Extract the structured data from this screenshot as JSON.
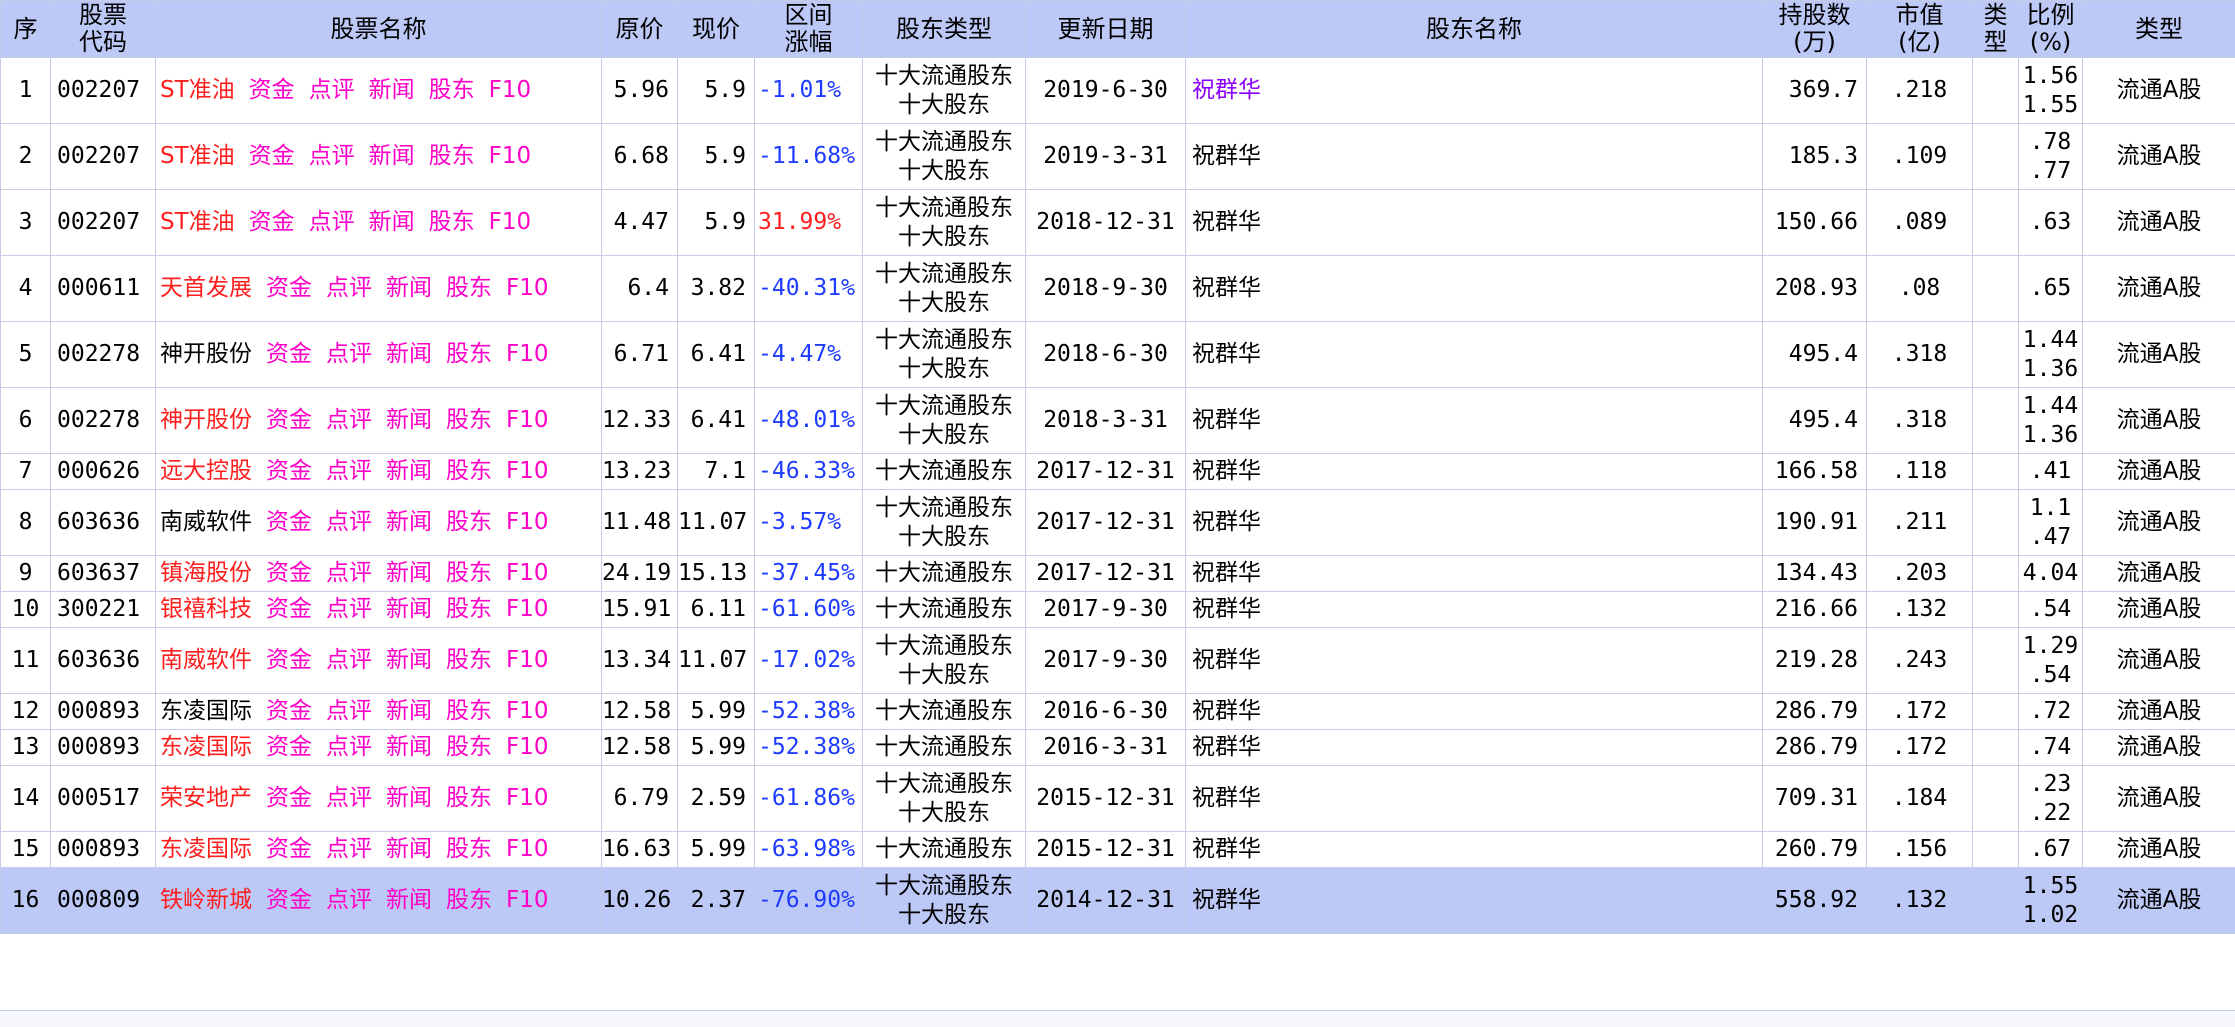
{
  "headers": {
    "seq": "序",
    "code": "股票\n代码",
    "name": "股票名称",
    "orig_price": "原价",
    "cur_price": "现价",
    "range_change": "区间\n涨幅",
    "holder_type": "股东类型",
    "update_date": "更新日期",
    "holder_name": "股东名称",
    "shares": "持股数\n(万)",
    "market_value": "市值\n(亿)",
    "kind": "类\n型",
    "ratio": "比例\n(%)",
    "share_type": "类型"
  },
  "link_labels": [
    "资金",
    "点评",
    "新闻",
    "股东",
    "F10"
  ],
  "rows": [
    {
      "seq": "1",
      "code": "002207",
      "stock": "ST准油",
      "stock_color": "red",
      "orig": "5.96",
      "cur": "5.9",
      "change": "-1.01%",
      "holder_type": [
        "十大流通股东",
        "十大股东"
      ],
      "date": "2019-6-30",
      "holder": "祝群华",
      "holder_color": "purple",
      "shares": "369.7",
      "mv": ".218",
      "ratio": [
        "1.56",
        "1.55"
      ],
      "type": "流通A股"
    },
    {
      "seq": "2",
      "code": "002207",
      "stock": "ST准油",
      "stock_color": "red",
      "orig": "6.68",
      "cur": "5.9",
      "change": "-11.68%",
      "holder_type": [
        "十大流通股东",
        "十大股东"
      ],
      "date": "2019-3-31",
      "holder": "祝群华",
      "holder_color": "black",
      "shares": "185.3",
      "mv": ".109",
      "ratio": [
        ".78",
        ".77"
      ],
      "type": "流通A股"
    },
    {
      "seq": "3",
      "code": "002207",
      "stock": "ST准油",
      "stock_color": "red",
      "orig": "4.47",
      "cur": "5.9",
      "change": "31.99%",
      "holder_type": [
        "十大流通股东",
        "十大股东"
      ],
      "date": "2018-12-31",
      "holder": "祝群华",
      "holder_color": "black",
      "shares": "150.66",
      "mv": ".089",
      "ratio": [
        ".63"
      ],
      "type": "流通A股"
    },
    {
      "seq": "4",
      "code": "000611",
      "stock": "天首发展",
      "stock_color": "red",
      "orig": "6.4",
      "cur": "3.82",
      "change": "-40.31%",
      "holder_type": [
        "十大流通股东",
        "十大股东"
      ],
      "date": "2018-9-30",
      "holder": "祝群华",
      "holder_color": "black",
      "shares": "208.93",
      "mv": ".08",
      "ratio": [
        ".65"
      ],
      "type": "流通A股"
    },
    {
      "seq": "5",
      "code": "002278",
      "stock": "神开股份",
      "stock_color": "black",
      "orig": "6.71",
      "cur": "6.41",
      "change": "-4.47%",
      "holder_type": [
        "十大流通股东",
        "十大股东"
      ],
      "date": "2018-6-30",
      "holder": "祝群华",
      "holder_color": "black",
      "shares": "495.4",
      "mv": ".318",
      "ratio": [
        "1.44",
        "1.36"
      ],
      "type": "流通A股"
    },
    {
      "seq": "6",
      "code": "002278",
      "stock": "神开股份",
      "stock_color": "red",
      "orig": "12.33",
      "cur": "6.41",
      "change": "-48.01%",
      "holder_type": [
        "十大流通股东",
        "十大股东"
      ],
      "date": "2018-3-31",
      "holder": "祝群华",
      "holder_color": "black",
      "shares": "495.4",
      "mv": ".318",
      "ratio": [
        "1.44",
        "1.36"
      ],
      "type": "流通A股"
    },
    {
      "seq": "7",
      "code": "000626",
      "stock": "远大控股",
      "stock_color": "red",
      "orig": "13.23",
      "cur": "7.1",
      "change": "-46.33%",
      "holder_type": [
        "十大流通股东"
      ],
      "date": "2017-12-31",
      "holder": "祝群华",
      "holder_color": "black",
      "shares": "166.58",
      "mv": ".118",
      "ratio": [
        ".41"
      ],
      "type": "流通A股"
    },
    {
      "seq": "8",
      "code": "603636",
      "stock": "南威软件",
      "stock_color": "black",
      "orig": "11.48",
      "cur": "11.07",
      "change": "-3.57%",
      "holder_type": [
        "十大流通股东",
        "十大股东"
      ],
      "date": "2017-12-31",
      "holder": "祝群华",
      "holder_color": "black",
      "shares": "190.91",
      "mv": ".211",
      "ratio": [
        "1.1",
        ".47"
      ],
      "type": "流通A股"
    },
    {
      "seq": "9",
      "code": "603637",
      "stock": "镇海股份",
      "stock_color": "red",
      "orig": "24.19",
      "cur": "15.13",
      "change": "-37.45%",
      "holder_type": [
        "十大流通股东"
      ],
      "date": "2017-12-31",
      "holder": "祝群华",
      "holder_color": "black",
      "shares": "134.43",
      "mv": ".203",
      "ratio": [
        "4.04"
      ],
      "type": "流通A股"
    },
    {
      "seq": "10",
      "code": "300221",
      "stock": "银禧科技",
      "stock_color": "red",
      "orig": "15.91",
      "cur": "6.11",
      "change": "-61.60%",
      "holder_type": [
        "十大流通股东"
      ],
      "date": "2017-9-30",
      "holder": "祝群华",
      "holder_color": "black",
      "shares": "216.66",
      "mv": ".132",
      "ratio": [
        ".54"
      ],
      "type": "流通A股"
    },
    {
      "seq": "11",
      "code": "603636",
      "stock": "南威软件",
      "stock_color": "red",
      "orig": "13.34",
      "cur": "11.07",
      "change": "-17.02%",
      "holder_type": [
        "十大流通股东",
        "十大股东"
      ],
      "date": "2017-9-30",
      "holder": "祝群华",
      "holder_color": "black",
      "shares": "219.28",
      "mv": ".243",
      "ratio": [
        "1.29",
        ".54"
      ],
      "type": "流通A股"
    },
    {
      "seq": "12",
      "code": "000893",
      "stock": "东凌国际",
      "stock_color": "black",
      "orig": "12.58",
      "cur": "5.99",
      "change": "-52.38%",
      "holder_type": [
        "十大流通股东"
      ],
      "date": "2016-6-30",
      "holder": "祝群华",
      "holder_color": "black",
      "shares": "286.79",
      "mv": ".172",
      "ratio": [
        ".72"
      ],
      "type": "流通A股"
    },
    {
      "seq": "13",
      "code": "000893",
      "stock": "东凌国际",
      "stock_color": "red",
      "orig": "12.58",
      "cur": "5.99",
      "change": "-52.38%",
      "holder_type": [
        "十大流通股东"
      ],
      "date": "2016-3-31",
      "holder": "祝群华",
      "holder_color": "black",
      "shares": "286.79",
      "mv": ".172",
      "ratio": [
        ".74"
      ],
      "type": "流通A股"
    },
    {
      "seq": "14",
      "code": "000517",
      "stock": "荣安地产",
      "stock_color": "red",
      "orig": "6.79",
      "cur": "2.59",
      "change": "-61.86%",
      "holder_type": [
        "十大流通股东",
        "十大股东"
      ],
      "date": "2015-12-31",
      "holder": "祝群华",
      "holder_color": "black",
      "shares": "709.31",
      "mv": ".184",
      "ratio": [
        ".23",
        ".22"
      ],
      "type": "流通A股"
    },
    {
      "seq": "15",
      "code": "000893",
      "stock": "东凌国际",
      "stock_color": "red",
      "orig": "16.63",
      "cur": "5.99",
      "change": "-63.98%",
      "holder_type": [
        "十大流通股东"
      ],
      "date": "2015-12-31",
      "holder": "祝群华",
      "holder_color": "black",
      "shares": "260.79",
      "mv": ".156",
      "ratio": [
        ".67"
      ],
      "type": "流通A股"
    },
    {
      "seq": "16",
      "code": "000809",
      "stock": "铁岭新城",
      "stock_color": "red",
      "orig": "10.26",
      "cur": "2.37",
      "change": "-76.90%",
      "holder_type": [
        "十大流通股东",
        "十大股东"
      ],
      "date": "2014-12-31",
      "holder": "祝群华",
      "holder_color": "black",
      "shares": "558.92",
      "mv": ".132",
      "ratio": [
        "1.55",
        "1.02"
      ],
      "type": "流通A股",
      "selected": true
    }
  ],
  "colors": {
    "header_bg": "#bcc8f6",
    "selected_bg": "#bcc8f6",
    "link": "#ff00c8",
    "red": "#ff1e1e",
    "negative": "#1e3cff",
    "holder_purple": "#8c00ff",
    "grid": "#c6cce8"
  }
}
